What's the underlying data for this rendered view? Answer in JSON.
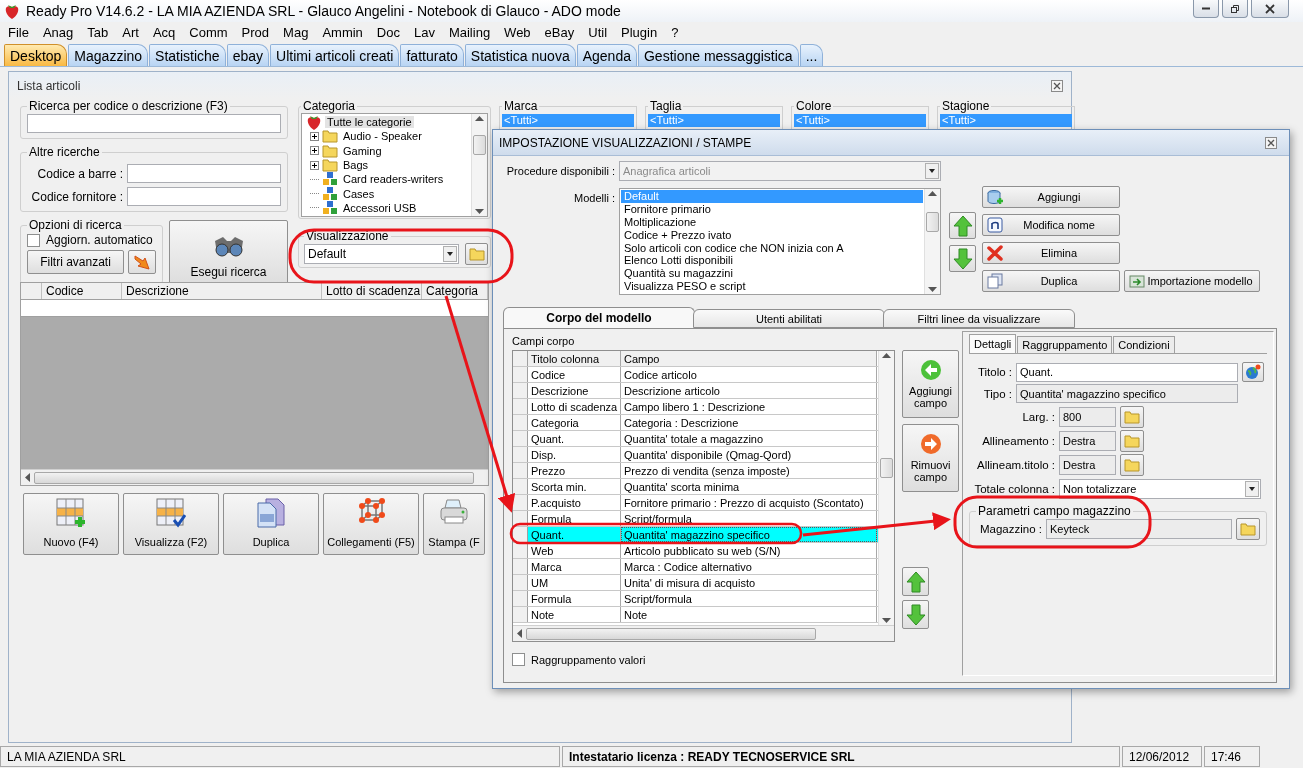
{
  "window": {
    "title": "Ready Pro V14.6.2 - LA MIA AZIENDA SRL - Glauco Angelini - Notebook di Glauco - ADO mode"
  },
  "menu": [
    "File",
    "Anag",
    "Tab",
    "Art",
    "Acq",
    "Comm",
    "Prod",
    "Mag",
    "Ammin",
    "Doc",
    "Lav",
    "Mailing",
    "Web",
    "eBay",
    "Util",
    "Plugin",
    "?"
  ],
  "tabs": [
    {
      "label": "Desktop",
      "selected": true
    },
    {
      "label": "Magazzino",
      "selected": false
    },
    {
      "label": "Statistiche",
      "selected": false
    },
    {
      "label": "ebay",
      "selected": false
    },
    {
      "label": "Ultimi articoli creati",
      "selected": false
    },
    {
      "label": "fatturato",
      "selected": false
    },
    {
      "label": "Statistica nuova",
      "selected": false
    },
    {
      "label": "Agenda",
      "selected": false
    },
    {
      "label": "Gestione messaggistica",
      "selected": false
    },
    {
      "label": "...",
      "selected": false
    }
  ],
  "lista_articoli": {
    "title": "Lista articoli",
    "search": {
      "legend": "Ricerca per codice o descrizione (F3)"
    },
    "other_searches": {
      "legend": "Altre ricerche",
      "fields": [
        {
          "label": "Codice a barre :"
        },
        {
          "label": "Codice fornitore :"
        }
      ]
    },
    "options": {
      "legend": "Opzioni di ricerca",
      "auto_update": {
        "label": "Aggiorn. automatico",
        "checked": false
      },
      "advanced_filters": "Filtri avanzati"
    },
    "search_button": "Esegui ricerca",
    "category": {
      "legend": "Categoria",
      "tree": [
        {
          "label": "Tutte le categorie",
          "kind": "root",
          "selected": true,
          "children": [
            {
              "label": "Audio - Speaker",
              "kind": "folder",
              "selected": false,
              "expandable": true
            },
            {
              "label": "Gaming",
              "kind": "folder",
              "selected": false,
              "expandable": true
            },
            {
              "label": "Bags",
              "kind": "folder",
              "selected": false,
              "expandable": true
            },
            {
              "label": "Card readers-writers",
              "kind": "cubes",
              "selected": false,
              "expandable": false
            },
            {
              "label": "Cases",
              "kind": "cubes",
              "selected": false,
              "expandable": false
            },
            {
              "label": "Accessori USB",
              "kind": "cubes",
              "selected": false,
              "expandable": false
            }
          ]
        }
      ]
    },
    "view": {
      "legend": "Visualizzazione",
      "value": "Default"
    },
    "filters": [
      {
        "legend": "Marca",
        "value": "<Tutti>"
      },
      {
        "legend": "Taglia",
        "value": "<Tutti>"
      },
      {
        "legend": "Colore",
        "value": "<Tutti>"
      },
      {
        "legend": "Stagione",
        "value": "<Tutti>"
      }
    ],
    "grid": {
      "columns": [
        "Codice",
        "Descrizione",
        "Lotto di scadenza",
        "Categoria"
      ]
    },
    "buttons": [
      {
        "label": "Nuovo (F4)",
        "kind": "new"
      },
      {
        "label": "Visualizza (F2)",
        "kind": "view"
      },
      {
        "label": "Duplica",
        "kind": "duplicate"
      },
      {
        "label": "Collegamenti (F5)",
        "kind": "links"
      },
      {
        "label": "Stampa (F",
        "kind": "print"
      }
    ]
  },
  "dialog": {
    "title": "IMPOSTAZIONE VISUALIZZAZIONI / STAMPE",
    "procedure": {
      "label": "Procedure disponibili :",
      "value": "Anagrafica articoli",
      "disabled": true
    },
    "models": {
      "label": "Modelli :",
      "items": [
        {
          "label": "Default",
          "selected": true
        },
        {
          "label": "Fornitore primario",
          "selected": false
        },
        {
          "label": "Moltiplicazione",
          "selected": false
        },
        {
          "label": "Codice + Prezzo ivato",
          "selected": false
        },
        {
          "label": "Solo articoli con codice che NON inizia con A",
          "selected": false
        },
        {
          "label": "Elenco Lotti disponibili",
          "selected": false
        },
        {
          "label": "Quantità su magazzini",
          "selected": false
        },
        {
          "label": "Visualizza PESO e script",
          "selected": false
        }
      ]
    },
    "actions": [
      {
        "label": "Aggiungi",
        "kind": "add"
      },
      {
        "label": "Modifica nome",
        "kind": "rename"
      },
      {
        "label": "Elimina",
        "kind": "delete"
      },
      {
        "label": "Duplica",
        "kind": "duplicate"
      },
      {
        "label": "Importazione modello",
        "kind": "import"
      }
    ],
    "tabs": [
      {
        "label": "Corpo del modello",
        "selected": true
      },
      {
        "label": "Utenti abilitati",
        "selected": false
      },
      {
        "label": "Filtri linee da visualizzare",
        "selected": false
      }
    ],
    "fields_label": "Campi corpo",
    "fields_grid": {
      "columns": [
        "Titolo colonna",
        "Campo"
      ],
      "rows": [
        {
          "title": "Codice",
          "field": "Codice articolo",
          "selected": false
        },
        {
          "title": "Descrizione",
          "field": "Descrizione articolo",
          "selected": false
        },
        {
          "title": "Lotto di scadenza",
          "field": "Campo libero 1 : Descrizione",
          "selected": false
        },
        {
          "title": "Categoria",
          "field": "Categoria : Descrizione",
          "selected": false
        },
        {
          "title": "Quant.",
          "field": "Quantita' totale a magazzino",
          "selected": false
        },
        {
          "title": "Disp.",
          "field": "Quantita' disponibile (Qmag-Qord)",
          "selected": false
        },
        {
          "title": "Prezzo",
          "field": "Prezzo di vendita (senza imposte)",
          "selected": false
        },
        {
          "title": "Scorta min.",
          "field": "Quantita' scorta minima",
          "selected": false
        },
        {
          "title": "P.acquisto",
          "field": "Fornitore primario : Prezzo di acquisto (Scontato)",
          "selected": false
        },
        {
          "title": "Formula",
          "field": "Script/formula",
          "selected": false
        },
        {
          "title": "Quant.",
          "field": "Quantita' magazzino specifico",
          "selected": true
        },
        {
          "title": "Web",
          "field": "Articolo pubblicato su web (S/N)",
          "selected": false
        },
        {
          "title": "Marca",
          "field": "Marca : Codice alternativo",
          "selected": false
        },
        {
          "title": "UM",
          "field": "Unita' di misura di acquisto",
          "selected": false
        },
        {
          "title": "Formula",
          "field": "Script/formula",
          "selected": false
        },
        {
          "title": "Note",
          "field": "Note",
          "selected": false
        }
      ]
    },
    "add_field": "Aggiungi campo",
    "remove_field": "Rimuovi campo",
    "group_values": {
      "label": "Raggruppamento valori",
      "checked": false
    },
    "details": {
      "tabs": [
        {
          "label": "Dettagli",
          "selected": true
        },
        {
          "label": "Raggruppamento",
          "selected": false
        },
        {
          "label": "Condizioni",
          "selected": false
        }
      ],
      "title": {
        "label": "Titolo :",
        "value": "Quant."
      },
      "type": {
        "label": "Tipo :",
        "value": "Quantita' magazzino specifico",
        "readonly": true
      },
      "settings": [
        {
          "label": "Larg. :",
          "value": "800",
          "readonly": true
        },
        {
          "label": "Allineamento :",
          "value": "Destra",
          "readonly": true
        },
        {
          "label": "Allineam.titolo :",
          "value": "Destra",
          "readonly": true
        }
      ],
      "total": {
        "label": "Totale colonna :",
        "value": "Non totalizzare"
      },
      "warehouse": {
        "legend": "Parametri campo magazzino",
        "label": "Magazzino :",
        "value": "Keyteck",
        "readonly": true
      }
    }
  },
  "status_bar": [
    "LA MIA AZIENDA SRL",
    "Intestatario licenza : READY TECNOSERVICE SRL",
    "12/06/2012",
    "17:46"
  ]
}
